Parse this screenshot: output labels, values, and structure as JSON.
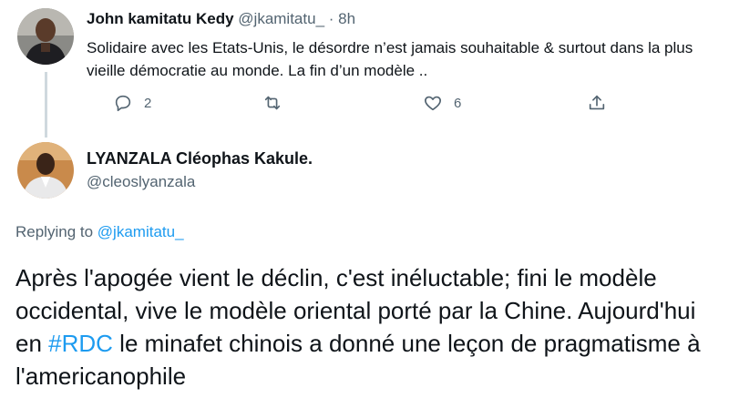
{
  "parent_tweet": {
    "display_name": "John kamitatu Kedy",
    "handle": "@jkamitatu_",
    "separator": "·",
    "time": "8h",
    "text": "Solidaire avec les Etats-Unis, le désordre n’est jamais souhaitable & surtout dans la plus vieille démocratie au monde.   La fin d’un modèle ..",
    "reply_count": "2",
    "retweet_count": "",
    "like_count": "6"
  },
  "reply_tweet": {
    "display_name": "LYANZALA Cléophas Kakule.",
    "handle": "@cleoslyanzala",
    "replying_to_prefix": "Replying to",
    "replying_to_handle": "@jkamitatu_",
    "text_part1": "Après l'apogée vient le déclin, c'est inéluctable; fini le modèle occidental, vive le modèle oriental porté par la Chine. Aujourd'hui en ",
    "hashtag": "#RDC",
    "text_part2": " le minafet chinois a donné une leçon de pragmatisme à l'americanophile"
  },
  "colors": {
    "link": "#1d9bf0",
    "muted": "#536471",
    "text": "#0f1419",
    "thread_line": "#cfd9de"
  }
}
